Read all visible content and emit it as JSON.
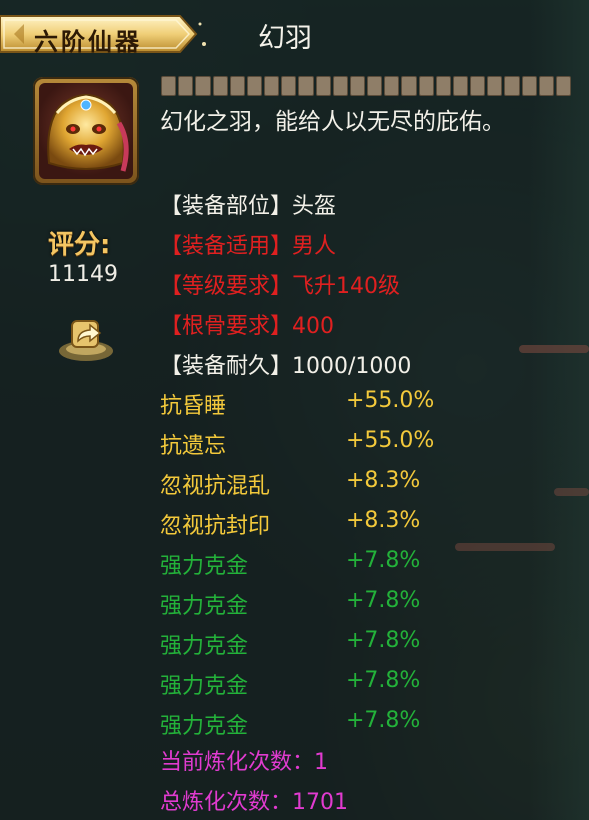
{
  "grade": "六阶仙器",
  "item_name": "幻羽",
  "description": "幻化之羽，能给人以无尽的庇佑。",
  "score_label": "评分:",
  "score_value": "11149",
  "refine_progress_segments": 24,
  "equip_info": [
    {
      "label": "【装备部位】",
      "value": "头盔",
      "color": "white"
    },
    {
      "label": "【装备适用】",
      "value": "男人",
      "color": "red"
    },
    {
      "label": "【等级要求】",
      "value": "飞升140级",
      "color": "red"
    },
    {
      "label": "【根骨要求】",
      "value": "400",
      "color": "red"
    },
    {
      "label": "【装备耐久】",
      "value": "1000/1000",
      "color": "white"
    }
  ],
  "attributes": [
    {
      "name": "抗昏睡",
      "value": "+55.0%",
      "color": "yellow"
    },
    {
      "name": "抗遗忘",
      "value": "+55.0%",
      "color": "yellow"
    },
    {
      "name": "忽视抗混乱",
      "value": "+8.3%",
      "color": "yellow"
    },
    {
      "name": "忽视抗封印",
      "value": "+8.3%",
      "color": "yellow"
    },
    {
      "name": "强力克金",
      "value": "+7.8%",
      "color": "green"
    },
    {
      "name": "强力克金",
      "value": "+7.8%",
      "color": "green"
    },
    {
      "name": "强力克金",
      "value": "+7.8%",
      "color": "green"
    },
    {
      "name": "强力克金",
      "value": "+7.8%",
      "color": "green"
    },
    {
      "name": "强力克金",
      "value": "+7.8%",
      "color": "green"
    }
  ],
  "refine": {
    "current_label": "当前炼化次数：",
    "current_value": "1",
    "total_label": "总炼化次数：",
    "total_value": "1701"
  },
  "colors": {
    "white": "#f2f0e8",
    "red": "#e02020",
    "yellow": "#f3c93b",
    "green": "#23b23a",
    "magenta": "#e13bd0",
    "gold": "#f4c663"
  },
  "icons": {
    "item": "golden-lion-helmet-icon",
    "share": "share-icon"
  }
}
